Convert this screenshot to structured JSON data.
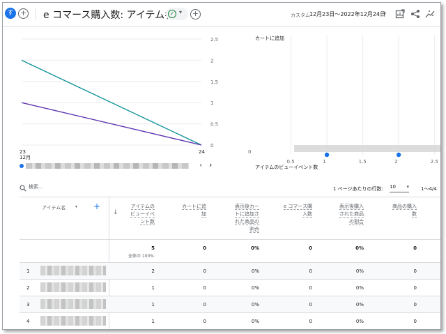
{
  "header": {
    "avatar_letter": "す",
    "add_symbol": "+",
    "title": "e コマース購入数: アイテム名",
    "check_symbol": "✓",
    "dropdown_symbol": "▾",
    "custom_label": "カスタム",
    "date_range": "12月23日〜2022年12月24日",
    "date_dropdown_symbol": "▾"
  },
  "left_chart": {
    "x_tick_first_day": "23",
    "x_tick_first_month": "12月",
    "x_tick_last": "24",
    "y_ticks": [
      "2.5",
      "2",
      "1.5",
      "1",
      "0.5",
      "0"
    ]
  },
  "right_chart": {
    "title": "カートに追加",
    "y_zero": "0",
    "x_ticks": [
      "0.5",
      "1",
      "1.5",
      "2",
      "2.5"
    ],
    "x_label": "アイテムのビューイベント数"
  },
  "legend_nav": {
    "prev": "‹",
    "next": "›"
  },
  "chart_data": [
    {
      "type": "line",
      "x": [
        "23",
        "24"
      ],
      "series": [
        {
          "values": [
            2,
            0
          ],
          "color": "#12939a"
        },
        {
          "values": [
            1,
            0
          ],
          "color": "#5e35b1"
        }
      ],
      "ylim": [
        0,
        2.5
      ]
    },
    {
      "type": "scatter",
      "title": "カートに追加",
      "xlabel": "アイテムのビューイベント数",
      "points": [
        {
          "x": 1,
          "y": 0
        },
        {
          "x": 2,
          "y": 0
        }
      ],
      "xlim": [
        0,
        2.5
      ],
      "color": "#1a73e8"
    }
  ],
  "toolbar": {
    "search_placeholder": "検索...",
    "rows_per_page_label": "1 ページあたりの行数:",
    "rows_per_page_value": "10",
    "rows_dropdown_symbol": "▾",
    "pagination": "1〜4/4"
  },
  "table": {
    "dimension_header": "アイテム名",
    "dimension_dropdown": "▾",
    "add_dimension": "+",
    "sort_arrow": "↓",
    "headers": [
      "アイテムの\nビューイベ\nント数",
      "カートに追\n加",
      "表示後カー\nトに追加さ\nれた商品の\n割合",
      "e コマース購\n入数",
      "表示後購入\nされた商品\nの割合",
      "商品の購入\n数"
    ],
    "totals": [
      "5",
      "0",
      "0%",
      "0",
      "0%",
      "0"
    ],
    "totals_sub": "全体の 100%",
    "rows": [
      {
        "n": "1",
        "cells": [
          "2",
          "0",
          "0%",
          "0",
          "0%",
          "0"
        ]
      },
      {
        "n": "2",
        "cells": [
          "1",
          "0",
          "0%",
          "0",
          "0%",
          "0"
        ]
      },
      {
        "n": "3",
        "cells": [
          "1",
          "0",
          "0%",
          "0",
          "0%",
          "0"
        ]
      },
      {
        "n": "4",
        "cells": [
          "1",
          "0",
          "0%",
          "0",
          "0%",
          "0"
        ]
      }
    ]
  }
}
